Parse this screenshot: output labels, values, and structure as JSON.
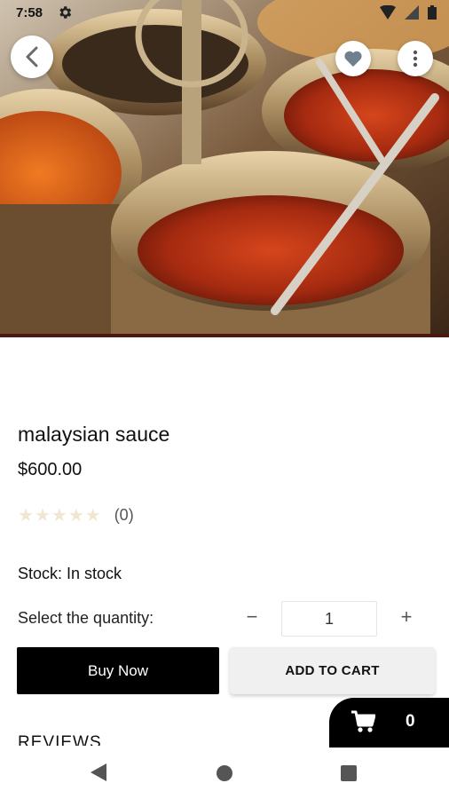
{
  "status_bar": {
    "time": "7:58"
  },
  "product": {
    "name": "malaysian sauce",
    "price": "$600.00",
    "rating": {
      "stars": 0,
      "max": 5,
      "count_text": "(0)"
    },
    "stock": "Stock: In stock"
  },
  "quantity": {
    "label": "Select the quantity:",
    "value": "1",
    "minus": "−",
    "plus": "+"
  },
  "actions": {
    "buy_now": "Buy Now",
    "add_to_cart": "ADD TO CART"
  },
  "cart": {
    "count": "0"
  },
  "sections": {
    "reviews": "REVIEWS"
  },
  "icons": {
    "back": "chevron-left-icon",
    "favorite": "heart-icon",
    "more": "more-vert-icon",
    "cart": "cart-icon",
    "settings": "gear-icon"
  },
  "colors": {
    "primary_button": "#000000",
    "secondary_button": "#f0f0f0",
    "star_empty": "#f1e6cf"
  }
}
